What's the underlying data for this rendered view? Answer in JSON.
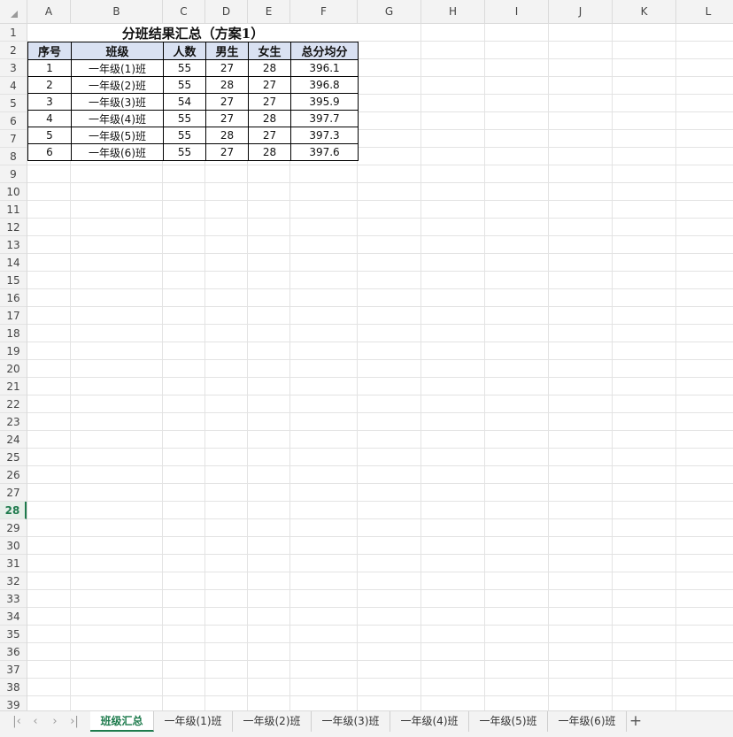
{
  "columns": [
    "A",
    "B",
    "C",
    "D",
    "E",
    "F",
    "G",
    "H",
    "I",
    "J",
    "K",
    "L"
  ],
  "rows": [
    "1",
    "2",
    "3",
    "4",
    "5",
    "6",
    "7",
    "8",
    "9",
    "10",
    "11",
    "12",
    "13",
    "14",
    "15",
    "16",
    "17",
    "18",
    "19",
    "20",
    "21",
    "22",
    "23",
    "24",
    "25",
    "26",
    "27",
    "28",
    "29",
    "30",
    "31",
    "32",
    "33",
    "34",
    "35",
    "36",
    "37",
    "38",
    "39"
  ],
  "active_row": "28",
  "sheet": {
    "title": "分班结果汇总（方案1）",
    "headers": [
      "序号",
      "班级",
      "人数",
      "男生",
      "女生",
      "总分均分"
    ],
    "data": [
      [
        "1",
        "一年级(1)班",
        "55",
        "27",
        "28",
        "396.1"
      ],
      [
        "2",
        "一年级(2)班",
        "55",
        "28",
        "27",
        "396.8"
      ],
      [
        "3",
        "一年级(3)班",
        "54",
        "27",
        "27",
        "395.9"
      ],
      [
        "4",
        "一年级(4)班",
        "55",
        "27",
        "28",
        "397.7"
      ],
      [
        "5",
        "一年级(5)班",
        "55",
        "28",
        "27",
        "397.3"
      ],
      [
        "6",
        "一年级(6)班",
        "55",
        "27",
        "28",
        "397.6"
      ]
    ]
  },
  "tabs": [
    "班级汇总",
    "一年级(1)班",
    "一年级(2)班",
    "一年级(3)班",
    "一年级(4)班",
    "一年级(5)班",
    "一年级(6)班"
  ],
  "active_tab": "班级汇总",
  "colors": {
    "accent": "#1e7b4d",
    "header_fill": "#d9e1f2"
  },
  "icons": [
    "select-all-triangle-icon",
    "first-sheet-icon",
    "prev-sheet-icon",
    "next-sheet-icon",
    "last-sheet-icon",
    "add-sheet-icon"
  ]
}
